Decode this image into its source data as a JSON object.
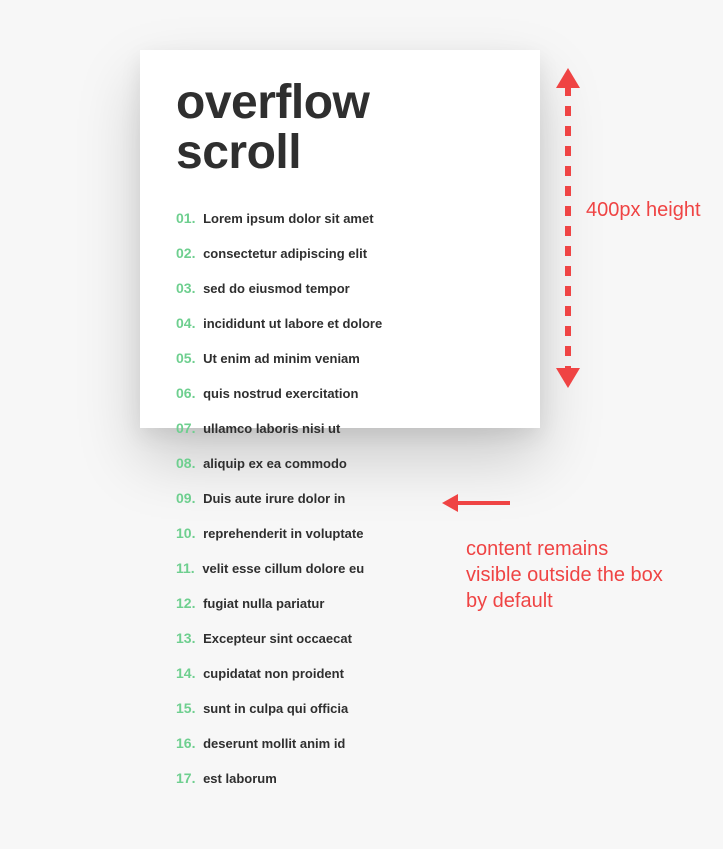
{
  "card": {
    "title": "overflow scroll",
    "items": [
      "Lorem ipsum dolor sit amet",
      "consectetur adipiscing elit",
      "sed do eiusmod tempor",
      "incididunt ut labore et dolore",
      "Ut enim ad minim veniam",
      "quis nostrud exercitation",
      "ullamco laboris nisi ut",
      "aliquip ex ea commodo",
      "Duis aute irure dolor in",
      "reprehenderit in voluptate",
      "velit esse cillum dolore eu",
      "fugiat nulla pariatur",
      "Excepteur sint occaecat",
      "cupidatat non proident",
      "sunt in culpa qui officia",
      "deserunt mollit anim id",
      "est laborum"
    ]
  },
  "annotations": {
    "height_label": "400px height",
    "overflow_label": "content remains visible outside the box by default"
  }
}
